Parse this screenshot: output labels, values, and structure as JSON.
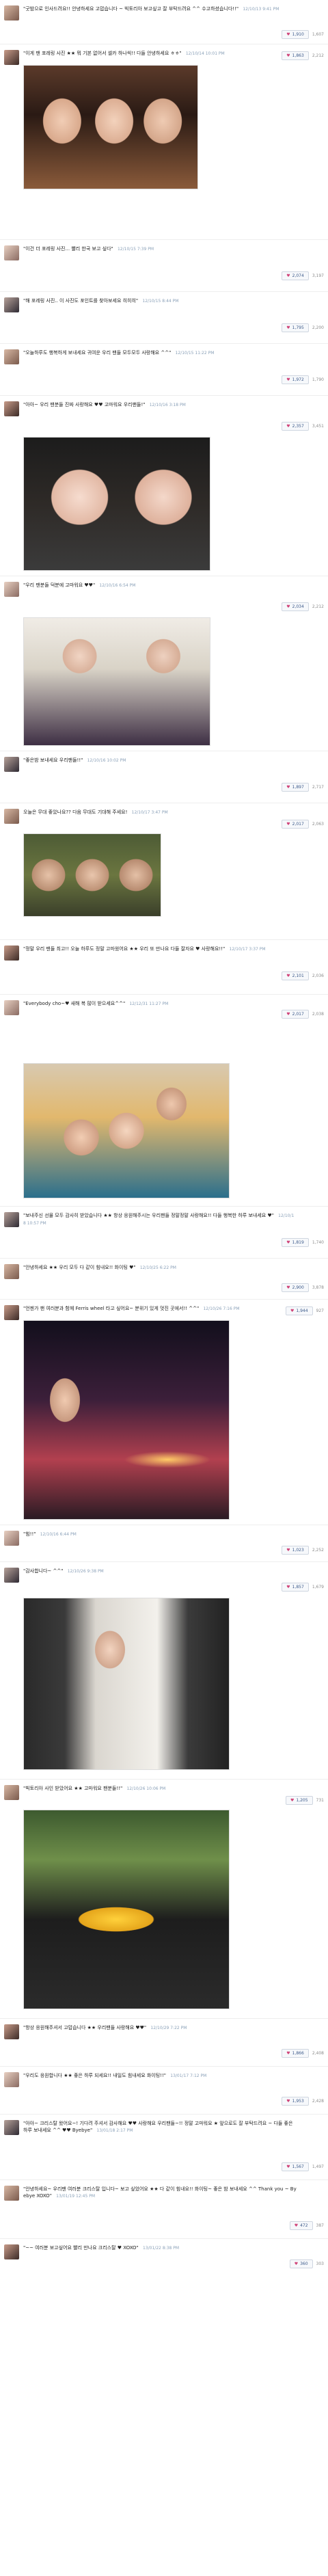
{
  "posts": [
    {
      "text": "\"굿밤으로 인사드려요!! 안녕하세요 고맙습니다 ~ 빅토리아 보고싶고 잘 부탁드려요 ^^ 수고하셨습니다!!\"",
      "time": "12/10/13 9:41 PM",
      "likes": "1,910",
      "count": "1,607"
    },
    {
      "text": "\"이게 팬 포레링 사진 ★★ 뭐 기본 없어서 셀카 하나씩!! 다들 안녕하세요 ㅎㅎ\"",
      "time": "12/10/14 10:01 PM",
      "likes": "1,863",
      "count": "2,212"
    },
    {
      "text": "\"이건 더 포레링 사진... 빨리 한국 보고 싶다\"",
      "time": "12/10/15 7:39 PM",
      "likes": "2,074",
      "count": "3,197"
    },
    {
      "text": "\"해 포레링 사진.. 이 사진도 포인트를 찾아보세요 히히히\"",
      "time": "12/10/15 8:44 PM",
      "likes": "1,795",
      "count": "2,200"
    },
    {
      "text": "\"오늘하루도 행복하게 보내세요 귀여운 우리 팬들 모두모두 사랑해요 ^^\"",
      "time": "12/10/15 11:22 PM",
      "likes": "1,972",
      "count": "1,790"
    },
    {
      "text": "\"아아~ 우리 팬분들 진짜 사랑해요 ♥♥ 고마워요 우리팬들!\"",
      "time": "12/10/16 3:18 PM",
      "likes": "2,357",
      "count": "3,451"
    },
    {
      "text": "\"우리 팬분들 덕분에 고마워요 ♥♥\"",
      "time": "12/10/16 6:54 PM",
      "likes": "2,034",
      "count": "2,212"
    },
    {
      "text": "\"좋은밤 보내세요 우리팬들!!\"",
      "time": "12/10/16 10:02 PM",
      "likes": "1,897",
      "count": "2,717"
    },
    {
      "text": "오늘은 무대 좋았나요?? 다음 무대도 기대해 주세요!",
      "time": "12/10/17 3:47 PM",
      "likes": "2,017",
      "count": "2,063"
    },
    {
      "text": "\"정말 우리 팬들 최고!! 오늘 하루도 정말 고마웠어요 ★★ 우리 또 만나요 다들 잘자요 ♥ 사랑해요!!\"",
      "time": "12/10/17 3:37 PM",
      "likes": "2,101",
      "count": "2,036"
    },
    {
      "text": "\"Everybody cho~♥ 새해 복 많이 받으세요^^\"",
      "time": "12/12/31 11:27 PM",
      "likes": "2,017",
      "count": "2,038"
    },
    {
      "text": "\"보내주신 선물 모두 감사히 받았습니다 ★★ 항상 응원해주시는 우리팬들 정말정말 사랑해요!! 다들 행복한 하루 보내세요 ♥\"",
      "time": "12/10/18 10:57 PM",
      "likes": "1,819",
      "count": "1,740"
    },
    {
      "text": "\"안녕하세요 ★★ 우리 모두 다 같이 힘내요!! 화이팅 ♥\"",
      "time": "12/10/25 6:22 PM",
      "likes": "2,900",
      "count": "3,878"
    },
    {
      "text": "\"언젠가 팬 여러분과 함께 Ferris wheel 타고 싶어요~ 분위기 있게 멋진 곳에서!! ^^\"",
      "time": "12/10/26 7:16 PM",
      "likes": "1,944",
      "count": "927"
    },
    {
      "text": "\"힘!!\"",
      "time": "12/10/16 6:44 PM",
      "likes": "1,023",
      "count": "2,252"
    },
    {
      "text": "\"감사합니다~ ^^\"",
      "time": "12/10/26 9:38 PM",
      "likes": "1,857",
      "count": "1,679"
    },
    {
      "text": "\"빅토리아 사인 받았어요 ★★ 고마워요 팬분들!!\"",
      "time": "12/10/26 10:06 PM",
      "likes": "1,205",
      "count": "731"
    },
    {
      "text": "\"항상 응원해주셔서 고맙습니다 ★★ 우리팬들 사랑해요 ♥♥\"",
      "time": "12/10/29 7:22 PM",
      "likes": "1,866",
      "count": "2,408"
    },
    {
      "text": "\"우리도 응원합니다 ★★ 좋은 하루 되세요!! 내일도 힘내세요 화이팅!!\"",
      "time": "13/01/17 7:12 PM",
      "likes": "1,953",
      "count": "2,428"
    },
    {
      "text": "\"아아~ 크리스탈 왔어요~! 기다려 주셔서 감사해요 ♥♥ 사랑해요 우리팬들~!! 정말 고마워요 ★ 앞으로도 잘 부탁드려요 ~ 다들 좋은 하루 보내세요 ^^ ♥♥ Byebye\"",
      "time": "13/01/18 2:17 PM",
      "likes": "1,567",
      "count": "1,497"
    },
    {
      "text": "\"안녕하세요~ 우리팬 여러분 크리스탈 입니다~ 보고 싶었어요 ★★ 다 같이 힘내요!! 화이팅~ 좋은 밤 보내세요 ^^ Thank you ~ Byebye XOXO\"",
      "time": "13/01/19 12:45 PM",
      "likes": "472",
      "count": "387"
    },
    {
      "text": "\"~~ 여러분 보고싶어요 빨리 만나요 크리스탈 ♥ XOXO\"",
      "time": "13/01/22 8:38 PM",
      "likes": "360",
      "count": "303"
    }
  ],
  "ui": {
    "like_label": "좋아요",
    "heart": "♥"
  }
}
